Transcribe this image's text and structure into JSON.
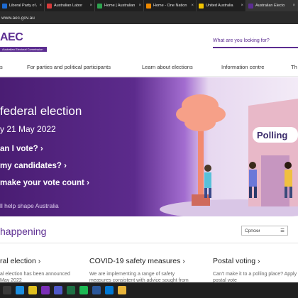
{
  "browser": {
    "tabs": [
      {
        "title": "Liberal Party of A",
        "color": "#1d6ad1"
      },
      {
        "title": "Australian Labor",
        "color": "#d83b3b"
      },
      {
        "title": "Home | Australian",
        "color": "#2ea44f"
      },
      {
        "title": "Home - One Nation",
        "color": "#f08a00"
      },
      {
        "title": "United Australia",
        "color": "#f2c400"
      },
      {
        "title": "Australian Electo",
        "color": "#5c2d91"
      }
    ],
    "url": "www.aec.gov.au"
  },
  "header": {
    "logo": "AEC",
    "logo_sub": "Australian Electoral Commission",
    "search_placeholder": "What are you looking for?"
  },
  "nav": {
    "items": [
      "s",
      "For parties and political participants",
      "Learn about elections",
      "Information centre",
      "Th"
    ]
  },
  "hero": {
    "title": "federal election",
    "date": "y 21 May 2022",
    "links": [
      "an I vote?",
      "my candidates?",
      "make your vote count"
    ],
    "tagline": "ll help shape Australia",
    "sign": "Polling"
  },
  "section": {
    "title": "happening",
    "language": "Српски",
    "cards": [
      {
        "title": "ral election",
        "body": [
          "al election has been announced",
          "May 2022"
        ]
      },
      {
        "title": "COVID-19 safety measures",
        "body": [
          "We are implementing a range of safety",
          "measures consistent with advice sought from"
        ]
      },
      {
        "title": "Postal voting",
        "body": [
          "Can't make it to a polling place? Apply",
          "postal vote"
        ]
      }
    ]
  },
  "taskbar": {
    "apps": [
      {
        "name": "task-view",
        "color": "#3a3a3a"
      },
      {
        "name": "edge",
        "color": "#1d8fe0"
      },
      {
        "name": "chrome",
        "color": "#e0c020"
      },
      {
        "name": "onenote",
        "color": "#7b2fb7"
      },
      {
        "name": "teams",
        "color": "#5059c9"
      },
      {
        "name": "excel",
        "color": "#1d7044"
      },
      {
        "name": "spotify",
        "color": "#1db954"
      },
      {
        "name": "word",
        "color": "#2b579a"
      },
      {
        "name": "store",
        "color": "#0078d4"
      },
      {
        "name": "files",
        "color": "#e8b43a"
      }
    ]
  }
}
